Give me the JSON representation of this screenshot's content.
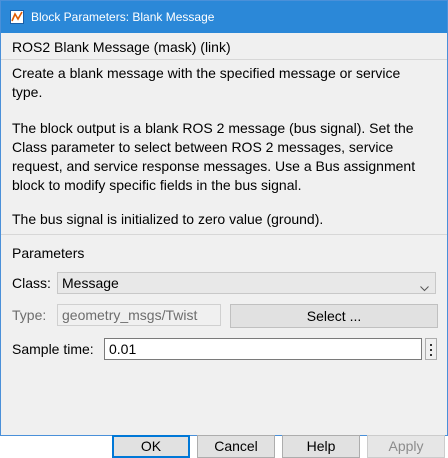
{
  "window": {
    "title": "Block Parameters: Blank Message"
  },
  "mask": {
    "header": "ROS2 Blank Message (mask) (link)",
    "description_1": "Create a blank message with the specified message or service type.",
    "description_2": "The block output is a blank ROS 2 message (bus signal). Set the Class parameter to select between ROS 2 messages, service request, and service response messages. Use a Bus assignment block to modify specific fields in the bus signal.",
    "description_3": "The bus signal is initialized to zero value (ground)."
  },
  "parameters": {
    "section_label": "Parameters",
    "class_label": "Class:",
    "class_value": "Message",
    "type_label": "Type:",
    "type_value": "geometry_msgs/Twist",
    "select_button": "Select ...",
    "sample_time_label": "Sample time:",
    "sample_time_value": "0.01"
  },
  "buttons": {
    "ok": "OK",
    "cancel": "Cancel",
    "help": "Help",
    "apply": "Apply"
  },
  "colors": {
    "titlebar": "#2b88d8",
    "ok_border": "#0078d7"
  },
  "icons": {
    "app": "simulink-block-icon",
    "dropdown": "chevron-down-icon",
    "more": "vertical-ellipsis-icon"
  }
}
